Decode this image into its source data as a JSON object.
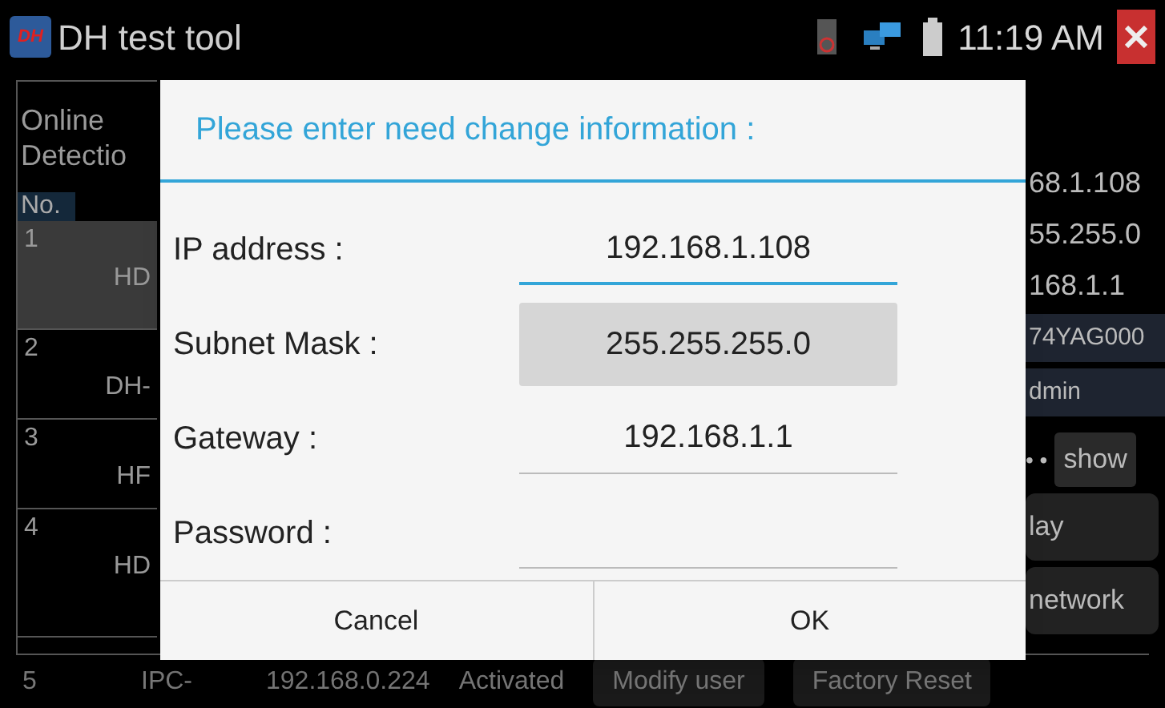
{
  "app_bar": {
    "title": "DH test tool",
    "logo": "DH",
    "time": "11:19 AM"
  },
  "list": {
    "heading": [
      "Online",
      "Detectio"
    ],
    "column_1": "No.",
    "rows": [
      {
        "number": "1",
        "text": "HD",
        "selected": true
      },
      {
        "number": "2",
        "text": "DH-",
        "selected": false
      },
      {
        "number": "3",
        "text": "HF",
        "selected": false
      },
      {
        "number": "4",
        "text": "HD",
        "selected": false
      }
    ],
    "last_row": {
      "number": "5",
      "model": "IPC-",
      "ip": "192.168.0.224",
      "status": "Activated",
      "buttons": [
        "Modify user",
        "Factory Reset"
      ]
    }
  },
  "details": {
    "values": [
      "68.1.108",
      "55.255.0",
      "168.1.1"
    ],
    "fields": [
      "74YAG000",
      "dmin"
    ],
    "password_dots": "• •",
    "show_button": "show",
    "buttons": [
      "lay",
      "network"
    ]
  },
  "dialog": {
    "title": "Please enter need change information :",
    "fields": [
      {
        "label": "IP address :",
        "value": "192.168.1.108",
        "kind": "text",
        "focused": true
      },
      {
        "label": "Subnet Mask :",
        "value": "255.255.255.0",
        "kind": "select",
        "focused": false
      },
      {
        "label": "Gateway :",
        "value": "192.168.1.1",
        "kind": "text",
        "focused": false
      },
      {
        "label": "Password :",
        "kind": "text",
        "focused": false
      }
    ],
    "buttons": [
      "Cancel",
      "OK"
    ]
  }
}
